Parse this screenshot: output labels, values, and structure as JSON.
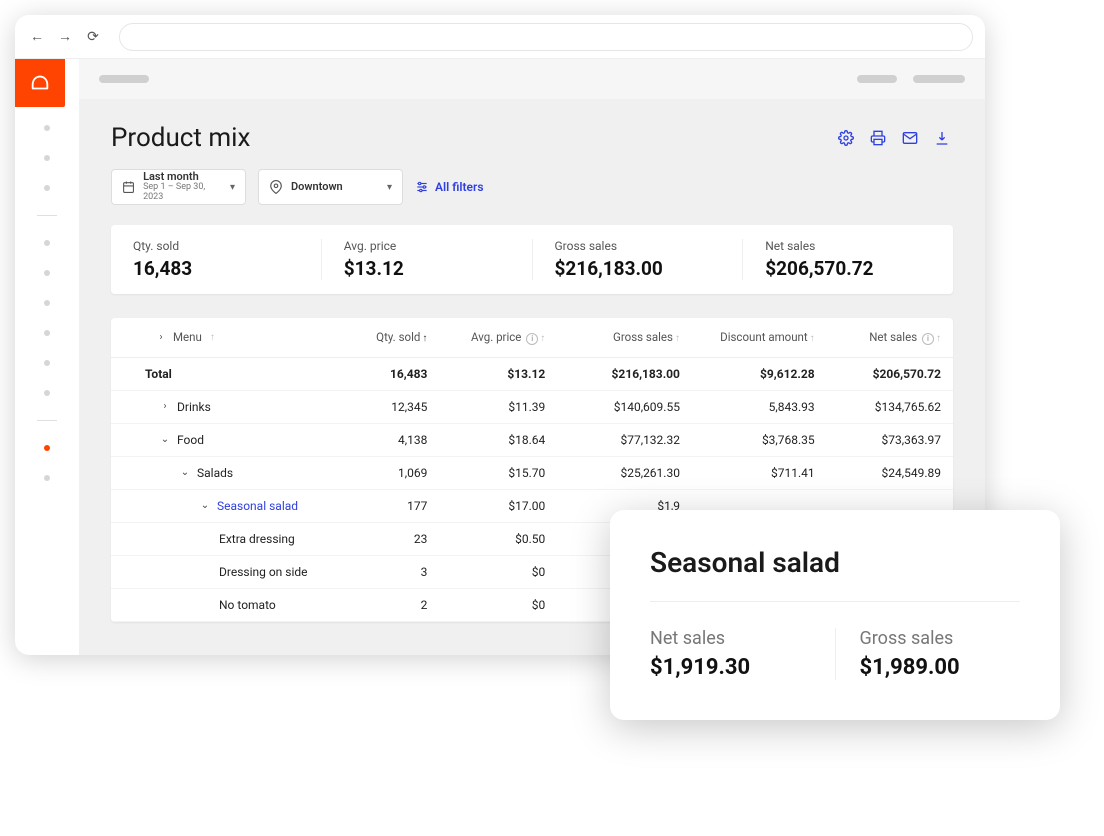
{
  "page": {
    "title": "Product mix"
  },
  "filters": {
    "date": {
      "primary": "Last month",
      "secondary": "Sep 1 – Sep 30, 2023"
    },
    "location": "Downtown",
    "all_filters_label": "All filters"
  },
  "kpis": {
    "qty_sold": {
      "label": "Qty. sold",
      "value": "16,483"
    },
    "avg_price": {
      "label": "Avg. price",
      "value": "$13.12"
    },
    "gross_sales": {
      "label": "Gross sales",
      "value": "$216,183.00"
    },
    "net_sales": {
      "label": "Net sales",
      "value": "$206,570.72"
    }
  },
  "table": {
    "columns": {
      "menu": "Menu",
      "qty_sold": "Qty. sold",
      "avg_price": "Avg. price",
      "gross_sales": "Gross sales",
      "discount": "Discount amount",
      "net_sales": "Net sales"
    },
    "rows": [
      {
        "kind": "total",
        "label": "Total",
        "indent": 0,
        "qty": "16,483",
        "avg": "$13.12",
        "gross": "$216,183.00",
        "discount": "$9,612.28",
        "net": "$206,570.72"
      },
      {
        "kind": "node",
        "expanded": false,
        "label": "Drinks",
        "indent": 1,
        "qty": "12,345",
        "avg": "$11.39",
        "gross": "$140,609.55",
        "discount": "5,843.93",
        "net": "$134,765.62"
      },
      {
        "kind": "node",
        "expanded": true,
        "label": "Food",
        "indent": 1,
        "qty": "4,138",
        "avg": "$18.64",
        "gross": "$77,132.32",
        "discount": "$3,768.35",
        "net": "$73,363.97"
      },
      {
        "kind": "node",
        "expanded": true,
        "label": "Salads",
        "indent": 2,
        "qty": "1,069",
        "avg": "$15.70",
        "gross": "$25,261.30",
        "discount": "$711.41",
        "net": "$24,549.89"
      },
      {
        "kind": "node",
        "expanded": true,
        "link": true,
        "label": "Seasonal salad",
        "indent": 3,
        "qty": "177",
        "avg": "$17.00",
        "gross": "$1,9",
        "discount": "",
        "net": ""
      },
      {
        "kind": "leaf",
        "label": "Extra dressing",
        "indent": 4,
        "qty": "23",
        "avg": "$0.50",
        "gross": "",
        "discount": "",
        "net": ""
      },
      {
        "kind": "leaf",
        "label": "Dressing on side",
        "indent": 4,
        "qty": "3",
        "avg": "$0",
        "gross": "",
        "discount": "",
        "net": ""
      },
      {
        "kind": "leaf",
        "label": "No tomato",
        "indent": 4,
        "qty": "2",
        "avg": "$0",
        "gross": "",
        "discount": "",
        "net": ""
      }
    ]
  },
  "detail": {
    "title": "Seasonal salad",
    "net_sales": {
      "label": "Net sales",
      "value": "$1,919.30"
    },
    "gross_sales": {
      "label": "Gross sales",
      "value": "$1,989.00"
    }
  },
  "sidebar": {
    "items": [
      {
        "active": false
      },
      {
        "active": false
      },
      {
        "active": false
      },
      {
        "sep": true
      },
      {
        "active": false
      },
      {
        "active": false
      },
      {
        "active": false
      },
      {
        "active": false
      },
      {
        "active": false
      },
      {
        "active": false
      },
      {
        "sep": true
      },
      {
        "active": true
      },
      {
        "active": false
      }
    ]
  }
}
